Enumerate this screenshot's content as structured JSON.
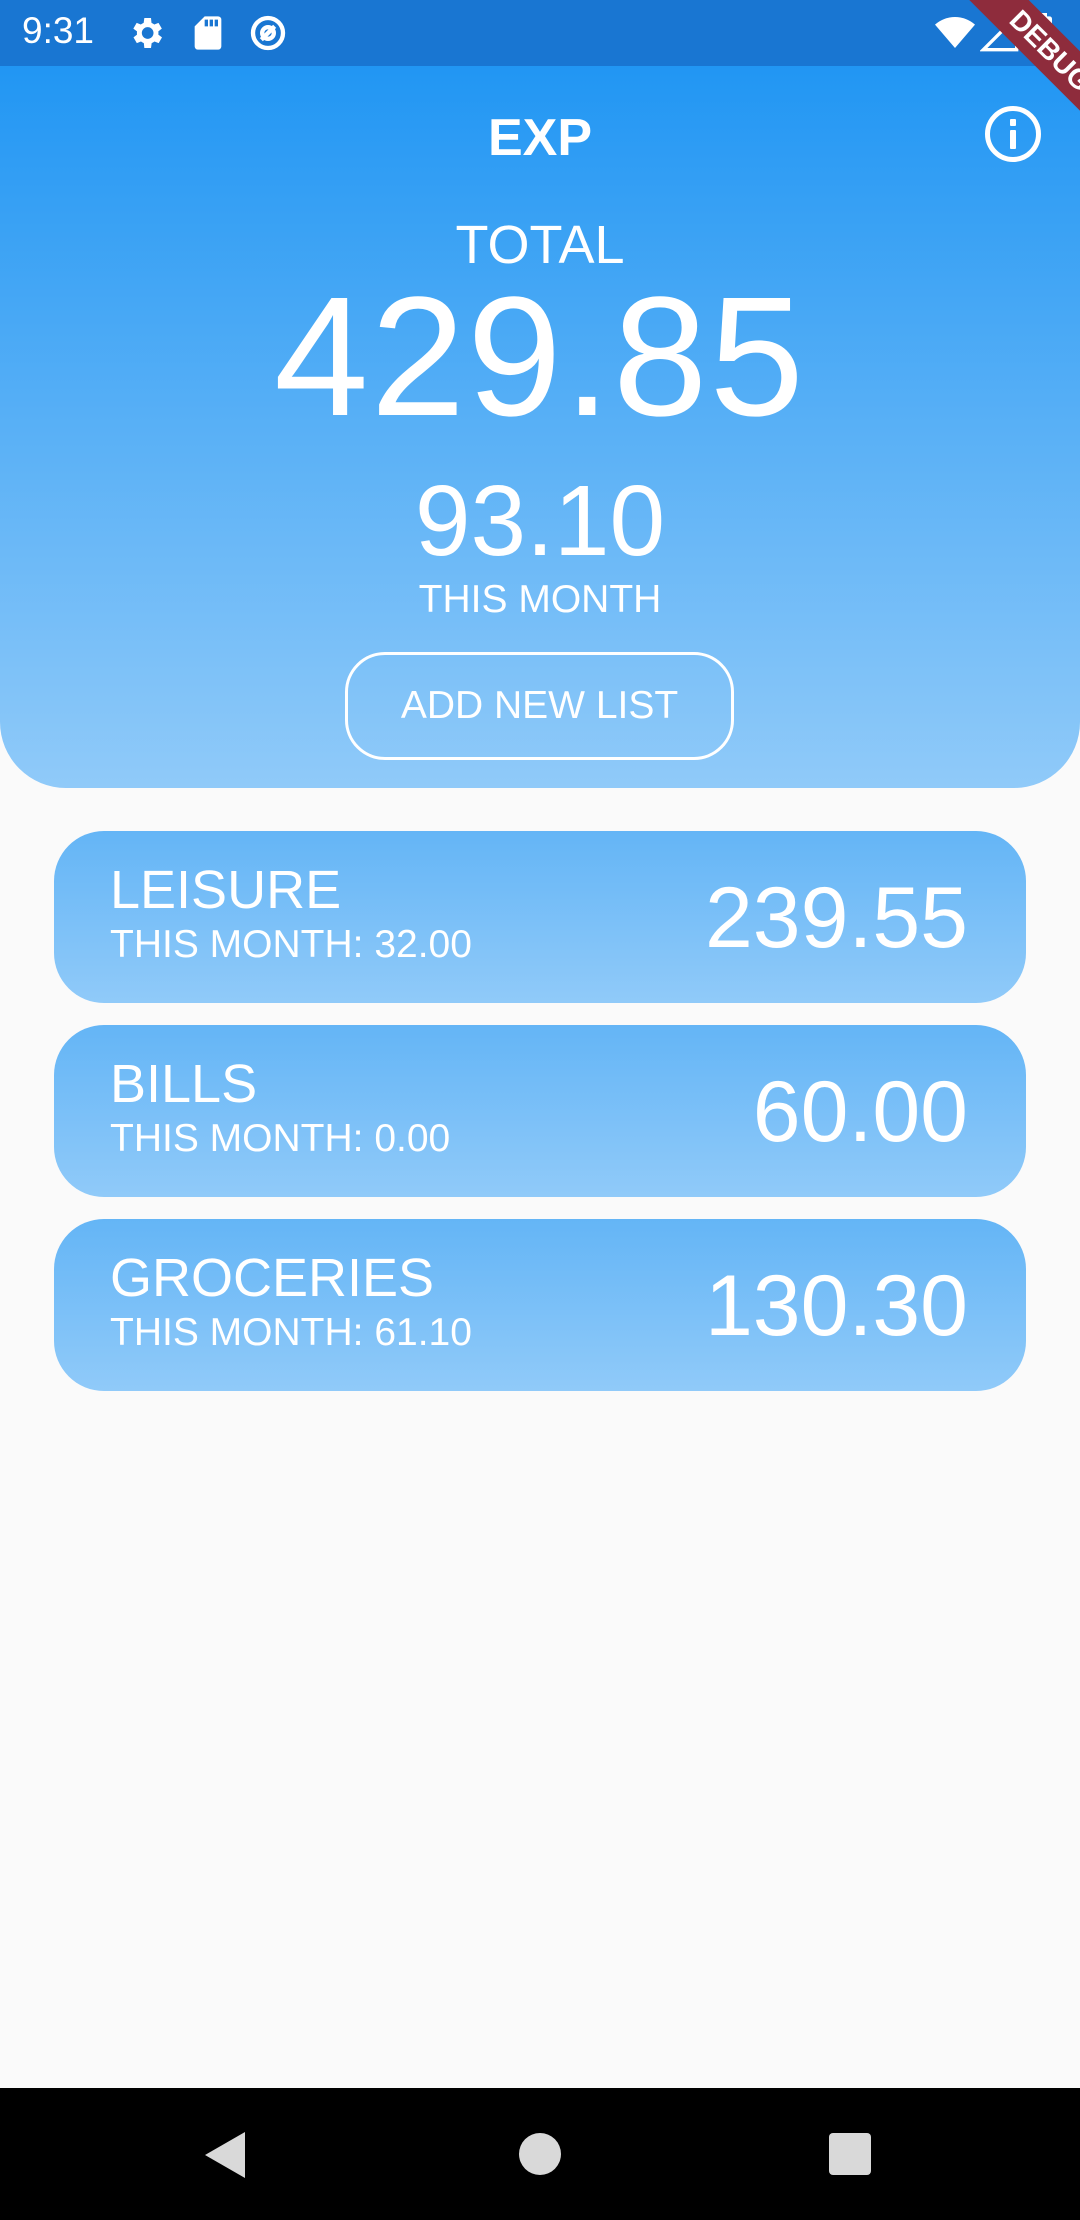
{
  "status_bar": {
    "time": "9:31",
    "icons": [
      "gear-icon",
      "sd-card-icon",
      "at-sync-icon",
      "wifi-icon",
      "signal-icon",
      "battery-icon"
    ],
    "background_color": "#1976d2"
  },
  "debug_banner": "DEBUG",
  "header": {
    "title": "EXP",
    "total_label": "TOTAL",
    "total_value": "429.85",
    "month_value": "93.10",
    "month_label": "THIS MONTH",
    "add_button_label": "ADD NEW LIST",
    "gradient_top": "#2196f3",
    "gradient_bottom": "#90caf9"
  },
  "lists": [
    {
      "name": "LEISURE",
      "month": "THIS MONTH: 32.00",
      "amount": "239.55"
    },
    {
      "name": "BILLS",
      "month": "THIS MONTH: 0.00",
      "amount": "60.00"
    },
    {
      "name": "GROCERIES",
      "month": "THIS MONTH: 61.10",
      "amount": "130.30"
    }
  ],
  "nav_bar": {
    "buttons": [
      "back-icon",
      "home-icon",
      "recents-icon"
    ]
  }
}
